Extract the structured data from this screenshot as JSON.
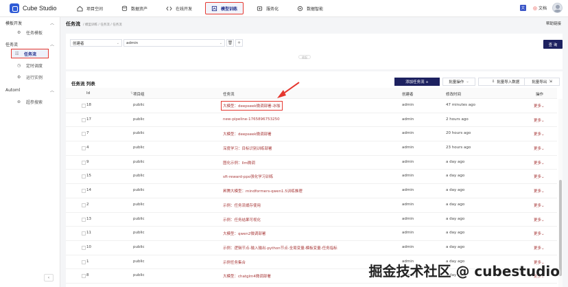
{
  "app": {
    "title": "Cube Studio"
  },
  "nav": {
    "items": [
      {
        "label": "项目空间",
        "icon": "home-icon"
      },
      {
        "label": "数据资产",
        "icon": "database-icon"
      },
      {
        "label": "在线开发",
        "icon": "code-icon"
      },
      {
        "label": "模型训练",
        "icon": "training-icon",
        "active": true
      },
      {
        "label": "服务化",
        "icon": "service-icon"
      },
      {
        "label": "数据智能",
        "icon": "intelligence-icon"
      }
    ],
    "doc_label": "文档"
  },
  "sidebar": {
    "groups": [
      {
        "label": "模板开发",
        "items": [
          {
            "label": "任务模板"
          }
        ]
      },
      {
        "label": "任务流",
        "items": [
          {
            "label": "任务流",
            "active": true
          },
          {
            "label": "定时调度"
          },
          {
            "label": "运行实例"
          }
        ]
      },
      {
        "label": "Automl",
        "items": [
          {
            "label": "超参搜索"
          }
        ]
      }
    ]
  },
  "page": {
    "title": "任务流",
    "breadcrumb": "/ 模型训练 / 任务流 / 任务流",
    "help": "帮助链接"
  },
  "filter": {
    "field": "创建者",
    "value": "admin",
    "query_button": "查 询",
    "collapse": "收起"
  },
  "table": {
    "title": "任务流 列表",
    "buttons": {
      "add": "添加任务流 +",
      "batch": "批量操作",
      "import": "批量导入数据",
      "export": "批量导出"
    },
    "columns": [
      "Id",
      "项目组",
      "任务流",
      "创建者",
      "修改时间",
      "操作"
    ],
    "more_label": "更多",
    "rows": [
      {
        "id": "18",
        "group": "public",
        "flow": "大模型：deepseek微调部署-冰咖",
        "creator": "admin",
        "time": "47 minutes ago"
      },
      {
        "id": "17",
        "group": "public",
        "flow": "new-pipeline-1765896753250",
        "creator": "admin",
        "time": "2 hours ago"
      },
      {
        "id": "7",
        "group": "public",
        "flow": "大模型：deepseek微调部署",
        "creator": "admin",
        "time": "20 hours ago"
      },
      {
        "id": "4",
        "group": "public",
        "flow": "深度学习：目标识别训练部署",
        "creator": "admin",
        "time": "23 hours ago"
      },
      {
        "id": "9",
        "group": "public",
        "flow": "图化示例：llm微调",
        "creator": "admin",
        "time": "a day ago"
      },
      {
        "id": "15",
        "group": "public",
        "flow": "sft-reward-ppo强化学习训练",
        "creator": "admin",
        "time": "a day ago"
      },
      {
        "id": "14",
        "group": "public",
        "flow": "昇腾大模型：mindformers-qwen1.5训练推理",
        "creator": "admin",
        "time": "a day ago"
      },
      {
        "id": "2",
        "group": "public",
        "flow": "示例：任务流缓存使用",
        "creator": "admin",
        "time": "a day ago"
      },
      {
        "id": "13",
        "group": "public",
        "flow": "示例：任务结果可视化",
        "creator": "admin",
        "time": "a day ago"
      },
      {
        "id": "11",
        "group": "public",
        "flow": "大模型：qwen2微调部署",
        "creator": "admin",
        "time": "a day ago"
      },
      {
        "id": "10",
        "group": "public",
        "flow": "示例：逻辑节点-输入输出-python节点-全局变量-模板变量-任务指标",
        "creator": "admin",
        "time": "a day ago"
      },
      {
        "id": "1",
        "group": "public",
        "flow": "示例任务集合",
        "creator": "admin",
        "time": "a day ago"
      },
      {
        "id": "8",
        "group": "public",
        "flow": "大模型：chatglm4微调部署",
        "creator": "admin",
        "time": "a day ago"
      }
    ]
  },
  "watermark": "掘金技术社区 @ cubestudio",
  "colors": {
    "accent": "#1d2160",
    "highlight": "#e5372f",
    "link": "#a83a3a"
  }
}
